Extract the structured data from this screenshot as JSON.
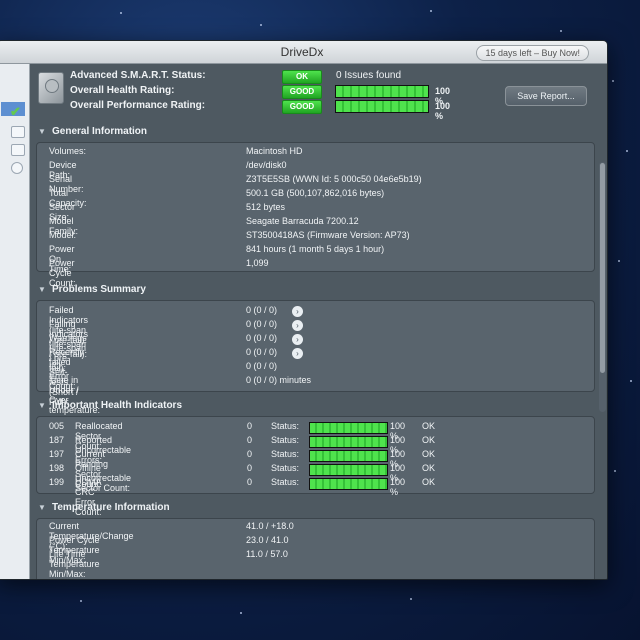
{
  "window": {
    "title": "DriveDx",
    "buy_label": "15 days left – Buy Now!"
  },
  "summary": {
    "smart_label": "Advanced S.M.A.R.T. Status:",
    "smart_badge": "OK",
    "smart_value": "0 Issues found",
    "health_label": "Overall Health Rating:",
    "health_badge": "GOOD",
    "health_pct": "100 %",
    "health_fill": 1.0,
    "perf_label": "Overall Performance Rating:",
    "perf_badge": "GOOD",
    "perf_pct": "100 %",
    "perf_fill": 1.0,
    "save_label": "Save Report..."
  },
  "general": {
    "title": "General Information",
    "rows": [
      {
        "k": "Volumes:",
        "v": "Macintosh HD"
      },
      {
        "k": "Device Path:",
        "v": "/dev/disk0"
      },
      {
        "k": "Serial Number:",
        "v": "Z3T5E5SB (WWN Id: 5 000c50 04e6e5b19)"
      },
      {
        "k": "Total Capacity:",
        "v": "500.1 GB (500,107,862,016 bytes)"
      },
      {
        "k": "Sector Size:",
        "v": "512 bytes"
      },
      {
        "k": "Model Family:",
        "v": "Seagate Barracuda 7200.12"
      },
      {
        "k": "Model:",
        "v": "ST3500418AS  (Firmware Version: AP73)"
      },
      {
        "k": "Power On Time:",
        "v": "841 hours (1 month 5 days 1 hour)"
      },
      {
        "k": "Power Cycle Count:",
        "v": "1,099"
      }
    ]
  },
  "problems": {
    "title": "Problems Summary",
    "rows": [
      {
        "k": "Failed Indicators (life-span / pre-fail):",
        "v": "0 (0 / 0)"
      },
      {
        "k": "Failing Indicators (life-span / pre-fail):",
        "v": "0 (0 / 0)"
      },
      {
        "k": "Warnings (life-span / pre-fail):",
        "v": "0 (0 / 0)"
      },
      {
        "k": "Recently failed Self-tests (Short / Full):",
        "v": "0 (0 / 0)"
      },
      {
        "k": "I/O Error Count:",
        "v": "0 (0 / 0)"
      },
      {
        "k": "Time in Under / Over temperature:",
        "v": "0 (0 / 0)  minutes"
      }
    ]
  },
  "health": {
    "title": "Important Health Indicators",
    "status_label": "Status:",
    "rows": [
      {
        "id": "005",
        "name": "Reallocated Sector Count:",
        "raw": "0",
        "pct": "100 %",
        "ok": "OK",
        "fill": 1.0
      },
      {
        "id": "187",
        "name": "Reported Uncorrectable Errors:",
        "raw": "0",
        "pct": "100 %",
        "ok": "OK",
        "fill": 1.0
      },
      {
        "id": "197",
        "name": "Current Pending Sector Count:",
        "raw": "0",
        "pct": "100 %",
        "ok": "OK",
        "fill": 1.0
      },
      {
        "id": "198",
        "name": "Offline Uncorrectable Sector Count:",
        "raw": "0",
        "pct": "100 %",
        "ok": "OK",
        "fill": 1.0
      },
      {
        "id": "199",
        "name": "UDMA CRC Error Count:",
        "raw": "0",
        "pct": "100 %",
        "ok": "OK",
        "fill": 1.0
      }
    ]
  },
  "temperature": {
    "title": "Temperature Information",
    "rows": [
      {
        "k": "Current Temperature/Change (°C):",
        "v": "41.0 / +18.0"
      },
      {
        "k": "Power Cycle Temperature Min/Max:",
        "v": "23.0 / 41.0"
      },
      {
        "k": "Life Time Temperature Min/Max:",
        "v": "11.0 / 57.0"
      }
    ]
  },
  "colors": {
    "good": "#34c236",
    "panel": "#59646d",
    "window": "#47525a"
  }
}
